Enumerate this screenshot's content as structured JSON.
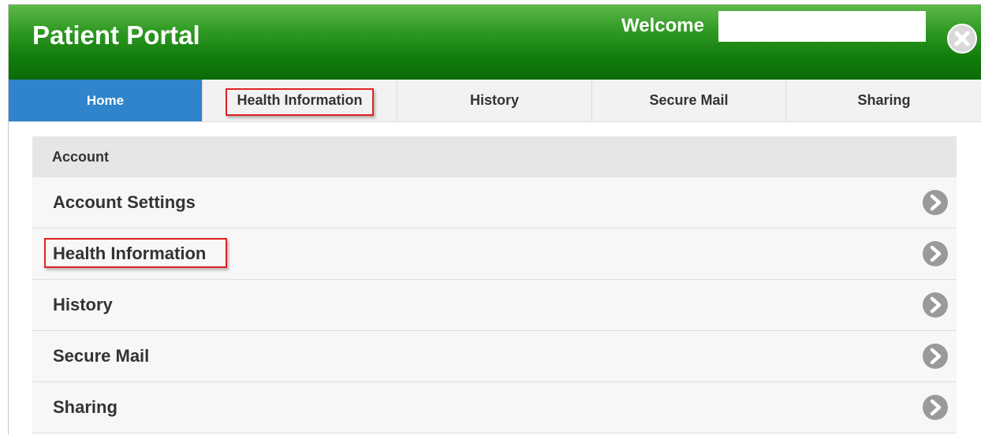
{
  "header": {
    "title": "Patient Portal",
    "welcome_label": "Welcome",
    "welcome_value": "",
    "close_icon": "close-circle-icon"
  },
  "tabs": [
    {
      "label": "Home",
      "active": true
    },
    {
      "label": "Health Information",
      "active": false,
      "highlighted": true
    },
    {
      "label": "History",
      "active": false
    },
    {
      "label": "Secure Mail",
      "active": false
    },
    {
      "label": "Sharing",
      "active": false
    }
  ],
  "account": {
    "section_label": "Account",
    "items": [
      {
        "label": "Account Settings"
      },
      {
        "label": "Health Information",
        "highlighted": true
      },
      {
        "label": "History"
      },
      {
        "label": "Secure Mail"
      },
      {
        "label": "Sharing"
      }
    ],
    "row_icon": "chevron-right-circle-icon"
  },
  "colors": {
    "header_green": "#127d0c",
    "active_tab_blue": "#2f84cb",
    "highlight_red": "#e02020"
  }
}
